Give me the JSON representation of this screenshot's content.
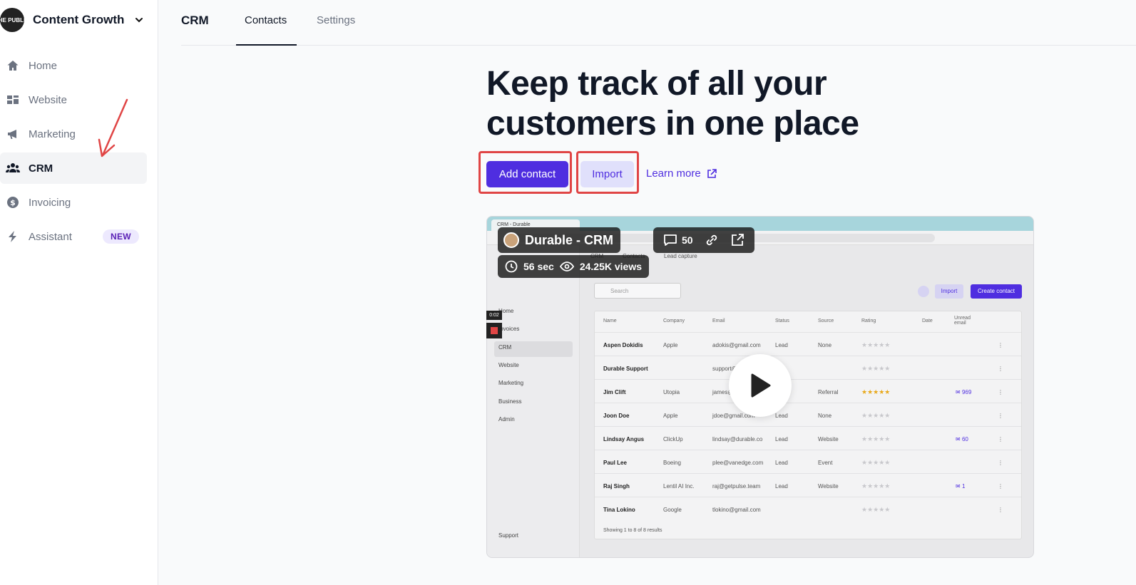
{
  "workspace": {
    "name": "Content Growth",
    "logo_text": "THE PUBLIC"
  },
  "sidebar": {
    "items": [
      {
        "label": "Home",
        "icon": "home-icon"
      },
      {
        "label": "Website",
        "icon": "website-icon"
      },
      {
        "label": "Marketing",
        "icon": "megaphone-icon"
      },
      {
        "label": "CRM",
        "icon": "users-icon",
        "active": true
      },
      {
        "label": "Invoicing",
        "icon": "dollar-icon"
      },
      {
        "label": "Assistant",
        "icon": "bolt-icon",
        "badge": "NEW"
      }
    ]
  },
  "header": {
    "brand": "CRM",
    "tabs": [
      {
        "label": "Contacts",
        "active": true
      },
      {
        "label": "Settings",
        "active": false
      }
    ]
  },
  "hero": {
    "line1": "Keep track of all your",
    "line2": "customers in one place",
    "add_contact": "Add contact",
    "import": "Import",
    "learn_more": "Learn more"
  },
  "video": {
    "title": "Durable - CRM",
    "duration": "56 sec",
    "views": "24.25K views",
    "comments": "50",
    "timer": "0:02",
    "browser_tab": "CRM - Durable",
    "app_tabs": [
      "CRM",
      "Contacts",
      "Lead capture"
    ],
    "side_items": [
      "Home",
      "Invoices",
      "CRM",
      "Website",
      "Marketing",
      "Business",
      "Admin"
    ],
    "support": "Support",
    "search_placeholder": "Search",
    "import_label": "Import",
    "create_label": "Create contact",
    "columns": [
      "Name",
      "Company",
      "Email",
      "Status",
      "Source",
      "Rating",
      "Date",
      "Unread email"
    ],
    "rows": [
      {
        "name": "Aspen Dokidis",
        "company": "Apple",
        "email": "adokis@gmail.com",
        "status": "Lead",
        "source": "None",
        "gold": false,
        "unread": ""
      },
      {
        "name": "Durable Support",
        "company": "",
        "email": "support@",
        "status": "",
        "source": "",
        "gold": false,
        "unread": ""
      },
      {
        "name": "Jim Clift",
        "company": "Utopia",
        "email": "james@",
        "status": "",
        "source": "Referral",
        "gold": true,
        "unread": "969"
      },
      {
        "name": "Joon Doe",
        "company": "Apple",
        "email": "jdoe@gmail.com",
        "status": "Lead",
        "source": "None",
        "gold": false,
        "unread": ""
      },
      {
        "name": "Lindsay Angus",
        "company": "ClickUp",
        "email": "lindsay@durable.co",
        "status": "Lead",
        "source": "Website",
        "gold": false,
        "unread": "60"
      },
      {
        "name": "Paul Lee",
        "company": "Boeing",
        "email": "plee@vanedge.com",
        "status": "Lead",
        "source": "Event",
        "gold": false,
        "unread": ""
      },
      {
        "name": "Raj Singh",
        "company": "Lentil AI Inc.",
        "email": "raj@getpulse.team",
        "status": "Lead",
        "source": "Website",
        "gold": false,
        "unread": "1"
      },
      {
        "name": "Tina Lokino",
        "company": "Google",
        "email": "tlokino@gmail.com",
        "status": "",
        "source": "",
        "gold": false,
        "unread": ""
      }
    ],
    "footer": "Showing 1 to 8 of 8 results"
  },
  "colors": {
    "accent": "#4f2ee0",
    "highlight": "#e04545"
  }
}
